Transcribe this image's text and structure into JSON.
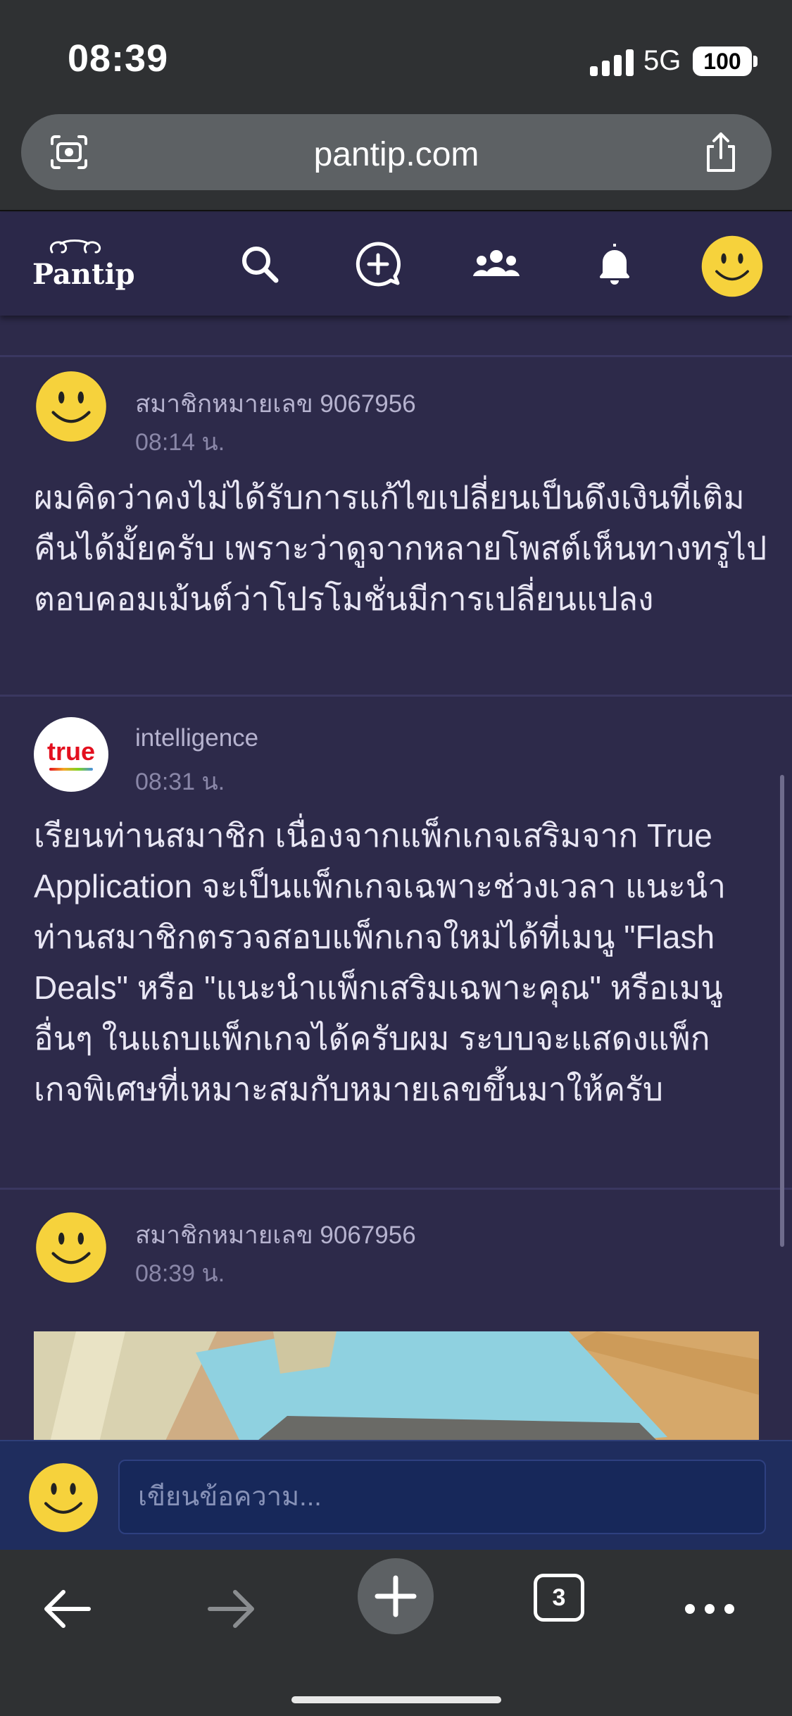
{
  "status_bar": {
    "time": "08:39",
    "network": "5G",
    "battery": "100"
  },
  "browser": {
    "url": "pantip.com",
    "tab_count": "3"
  },
  "site": {
    "logo_text": "Pantip"
  },
  "posts": [
    {
      "author": "สมาชิกหมายเลข 9067956",
      "time": "08:14 น.",
      "lines": [
        "ผมคิดว่าคงไม่ได้รับการแก้ไขเปลี่ยนเป็นดึงเงินที่เติม",
        "คืนได้มั้ยครับ เพราะว่าดูจากหลายโพสต์เห็นทางทรูไป",
        "ตอบคอมเม้นต์ว่าโปรโมชั่นมีการเปลี่ยนแปลง"
      ]
    },
    {
      "author": "intelligence",
      "time": "08:31 น.",
      "avatar_text": "true",
      "lines": [
        "เรียนท่านสมาชิก เนื่องจากแพ็กเกจเสริมจาก  True",
        "Application จะเป็นแพ็กเกจเฉพาะช่วงเวลา แนะนำ",
        "ท่านสมาชิกตรวจสอบแพ็กเกจใหม่ได้ที่เมนู \"Flash",
        "Deals\" หรือ \"แนะนำแพ็กเสริมเฉพาะคุณ\"  หรือเมนู",
        "อื่นๆ ในแถบแพ็กเกจได้ครับผม ระบบจะแสดงแพ็ก",
        "เกจพิเศษที่เหมาะสมกับหมายเลขขึ้นมาให้ครับ"
      ]
    },
    {
      "author": "สมาชิกหมายเลข 9067956",
      "time": "08:39 น."
    }
  ],
  "composer": {
    "placeholder": "เขียนข้อความ..."
  },
  "icons": {
    "search": "search-icon",
    "new_topic": "add-comment-icon",
    "community": "community-icon",
    "notifications": "bell-icon",
    "back": "arrow-left-icon",
    "forward": "arrow-right-icon",
    "new_tab": "plus-icon",
    "more": "more-icon"
  },
  "colors": {
    "header": "#2b2849",
    "content": "#2d2a4a",
    "composer": "#1f2d5e",
    "browser_chrome": "#2f3133"
  }
}
